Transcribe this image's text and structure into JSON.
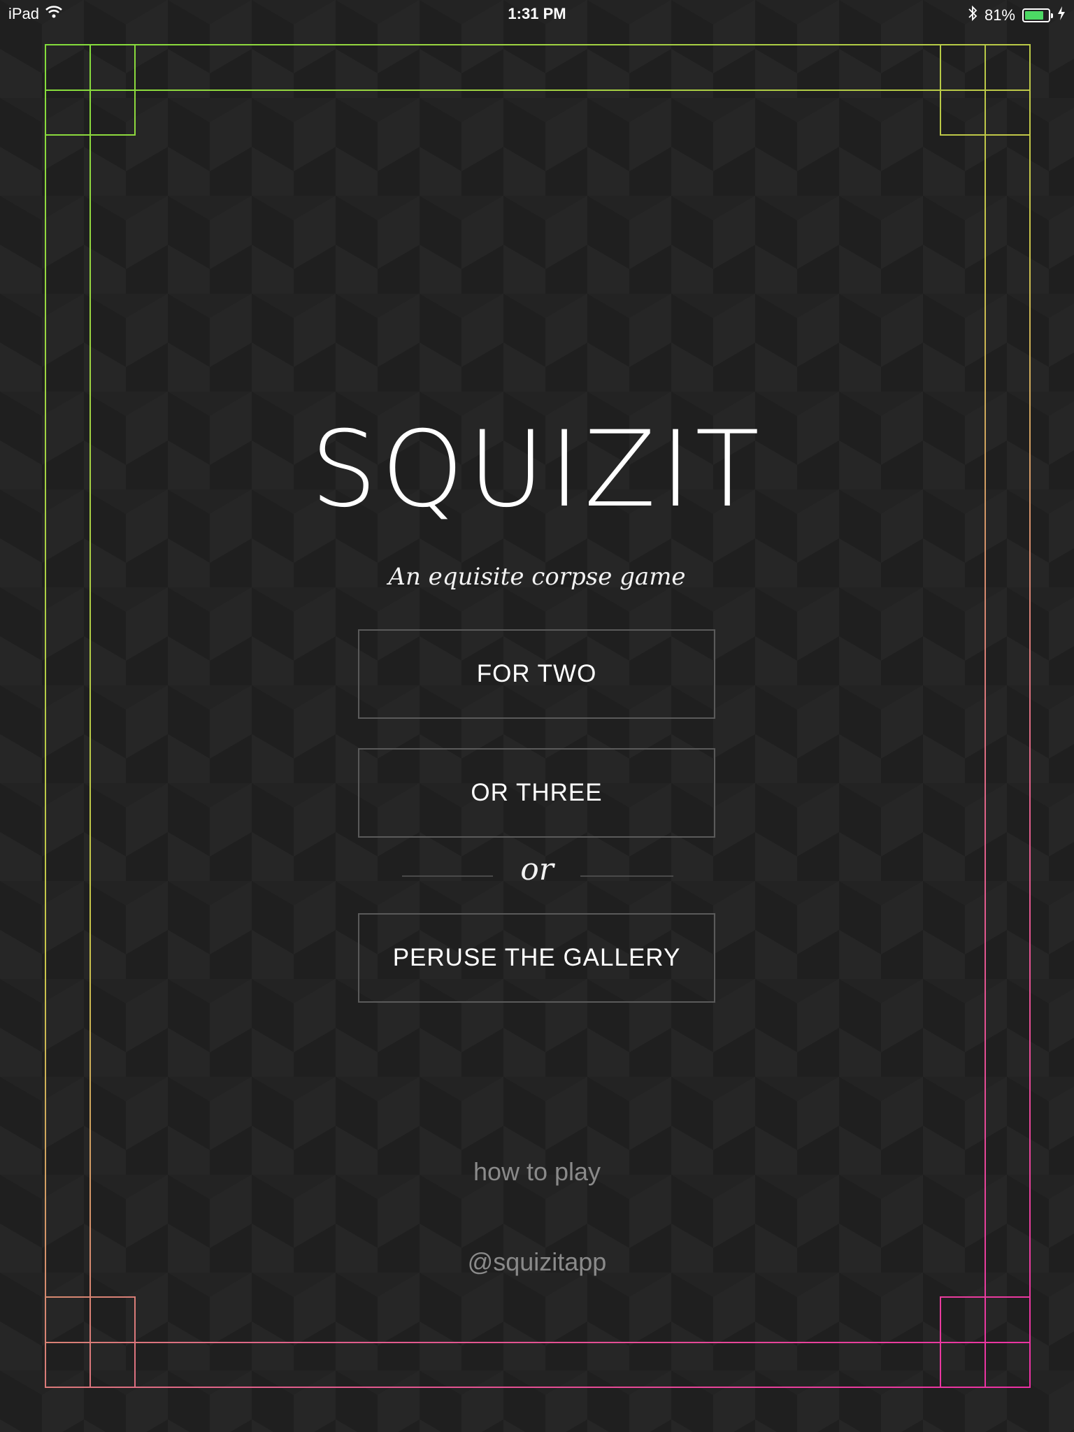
{
  "status_bar": {
    "device": "iPad",
    "time": "1:31 PM",
    "battery_percent_label": "81%",
    "battery_level": 0.81,
    "icons": [
      "wifi-icon",
      "bluetooth-icon",
      "battery-icon",
      "charging-icon"
    ]
  },
  "app": {
    "title": "SQUIZIT",
    "subtitle": "An equisite corpse game"
  },
  "menu": {
    "for_two": "FOR TWO",
    "or_three": "OR THREE",
    "divider": "or",
    "gallery": "PERUSE THE GALLERY"
  },
  "footer": {
    "how_to_play": "how to play",
    "handle": "@squizitapp"
  },
  "colors": {
    "background": "#232323",
    "frame_top_left": "#7ddf3a",
    "frame_top_right": "#c9c44a",
    "frame_bottom_left": "#e0608a",
    "frame_bottom_right": "#ee2aa8",
    "button_border": "#5a5a5a",
    "muted_text": "#8a8a8a"
  }
}
